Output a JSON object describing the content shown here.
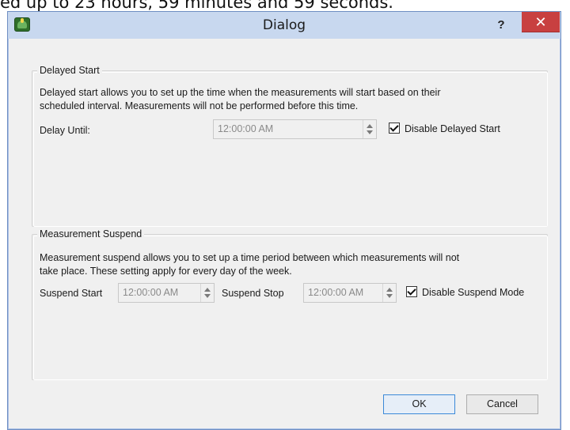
{
  "background_text": "ed up to 23 hours, 59 minutes and 59 seconds.",
  "window": {
    "title": "Dialog",
    "help_label": "?",
    "close_label": "✕",
    "app_icon": "app-logo-icon"
  },
  "delayed_start": {
    "group_title": "Delayed Start",
    "description_line1": "Delayed start allows you to set up the time when the measurements will start based on their",
    "description_line2": "scheduled interval. Measurements will not be performed before this time.",
    "delay_until_label": "Delay Until:",
    "delay_until_value": "12:00:00 AM",
    "disable_checkbox_label": "Disable Delayed Start",
    "disable_checked": true
  },
  "measurement_suspend": {
    "group_title": "Measurement Suspend",
    "description_line1": "Measurement suspend allows you to set up a time period between which measurements will not",
    "description_line2": "take place. These setting apply for every day of the week.",
    "suspend_start_label": "Suspend Start",
    "suspend_start_value": "12:00:00 AM",
    "suspend_stop_label": "Suspend Stop",
    "suspend_stop_value": "12:00:00 AM",
    "disable_checkbox_label": "Disable Suspend Mode",
    "disable_checked": true
  },
  "buttons": {
    "ok_label": "OK",
    "cancel_label": "Cancel"
  }
}
